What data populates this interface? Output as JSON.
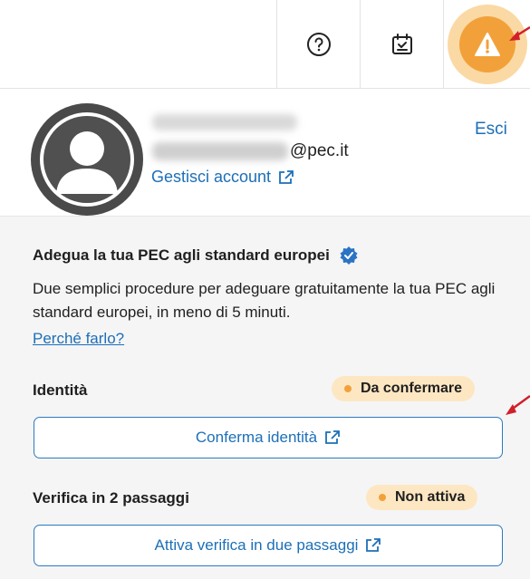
{
  "topbar": {
    "help_icon": "question-circle-icon",
    "tasks_icon": "calendar-check-icon",
    "alert_icon": "warning-triangle-icon",
    "alert_color": "#f2a13a"
  },
  "account": {
    "email_domain": "@pec.it",
    "manage_label": "Gestisci account",
    "logout_label": "Esci"
  },
  "notice": {
    "title": "Adegua la tua PEC agli standard europei",
    "description": "Due semplici procedure per adeguare gratuitamente la tua PEC agli standard europei, in meno di 5 minuti.",
    "why_link": "Perché farlo?"
  },
  "identity": {
    "label": "Identità",
    "status": "Da confermare",
    "button": "Conferma identità"
  },
  "two_step": {
    "label": "Verifica in 2 passaggi",
    "status": "Non attiva",
    "button": "Attiva verifica in due passaggi"
  },
  "colors": {
    "link": "#1c6fb8",
    "badge_bg": "#fde7c3",
    "annotation_arrow": "#d0202a"
  }
}
